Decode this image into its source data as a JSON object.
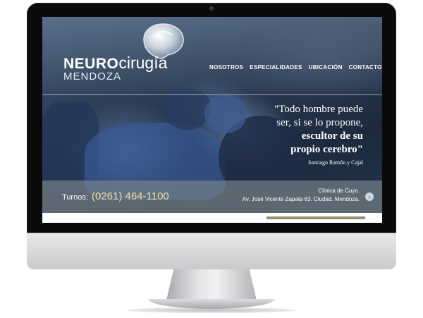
{
  "site": {
    "logo": {
      "neuro": "NEURO",
      "cirugia": "cirugía",
      "city": "MENDOZA"
    },
    "nav": [
      "NOSOTROS",
      "ESPECIALIDADES",
      "UBICACIÓN",
      "CONTACTO"
    ],
    "quote": {
      "line1": "\"Todo hombre puede",
      "line2": "ser, si se lo propone,",
      "line3": "escultor de su",
      "line4": "propio cerebro\"",
      "author": "Santiago Ramón y Cajal"
    },
    "contact": {
      "turnos_label": "Turnos:",
      "phone": "(0261) 464-1100",
      "clinic_line1": "Clínica de Cuyo.",
      "clinic_line2": "Av. José Vicente Zapata 63. Ciudad. Mendoza."
    },
    "arrow_icon": "chevron-right-icon",
    "colors": {
      "accent_gold": "#f0dca0",
      "bar": "#7d878c"
    }
  }
}
